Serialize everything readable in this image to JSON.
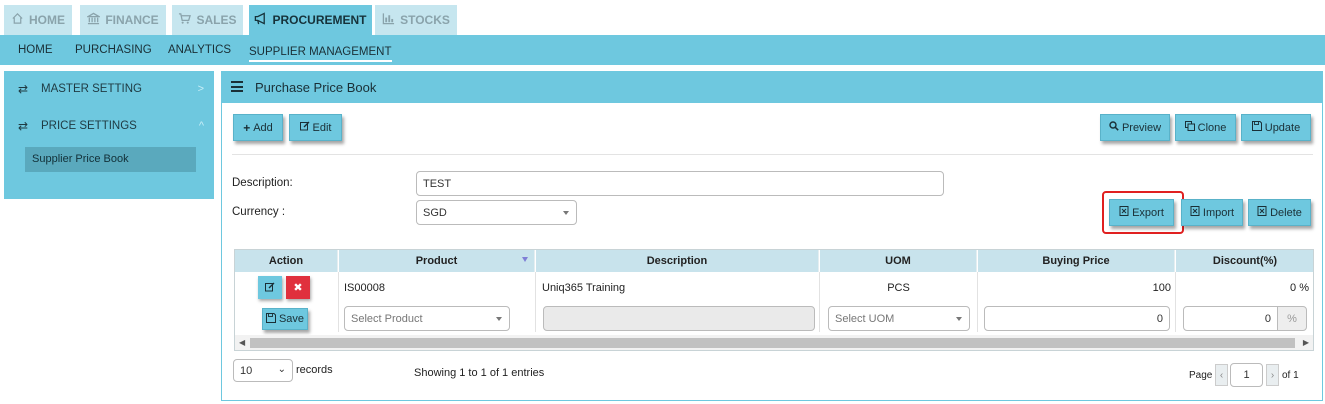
{
  "top_tabs": [
    {
      "label": "HOME",
      "icon": "home-icon"
    },
    {
      "label": "FINANCE",
      "icon": "bank-icon"
    },
    {
      "label": "SALES",
      "icon": "cart-icon"
    },
    {
      "label": "PROCUREMENT",
      "icon": "megaphone-icon"
    },
    {
      "label": "STOCKS",
      "icon": "bar-chart-icon"
    }
  ],
  "subnav": [
    "HOME",
    "PURCHASING",
    "ANALYTICS",
    "SUPPLIER MANAGEMENT"
  ],
  "sidebar": {
    "items": [
      {
        "label": "MASTER SETTING",
        "chevron": ">"
      },
      {
        "label": "PRICE SETTINGS",
        "chevron": "^"
      }
    ],
    "sub_item": "Supplier Price Book"
  },
  "panel": {
    "title": "Purchase Price Book",
    "buttons": {
      "add": "Add",
      "edit": "Edit",
      "preview": "Preview",
      "clone": "Clone",
      "update": "Update",
      "export": "Export",
      "import": "Import",
      "delete": "Delete"
    },
    "form": {
      "description_label": "Description:",
      "description_value": "TEST",
      "currency_label": "Currency :",
      "currency_value": "SGD"
    }
  },
  "table": {
    "headers": [
      "Action",
      "Product",
      "Description",
      "UOM",
      "Buying Price",
      "Discount(%)"
    ],
    "row": {
      "product": "IS00008",
      "description": "Uniq365 Training",
      "uom": "PCS",
      "buying_price": "100",
      "discount": "0 %"
    },
    "new_row": {
      "save_label": "Save",
      "product_placeholder": "Select Product",
      "uom_placeholder": "Select UOM",
      "buying_price": "0",
      "discount": "0",
      "discount_unit": "%"
    }
  },
  "footer": {
    "page_size": "10",
    "records_label": "records",
    "showing": "Showing 1 to 1 of 1 entries",
    "page_label": "Page",
    "page_value": "1",
    "of_label": "of 1"
  },
  "colors": {
    "accent": "#6ec8df",
    "tab_inactive": "#c6e6ef",
    "danger": "#e0303d",
    "highlight": "#e02020"
  }
}
